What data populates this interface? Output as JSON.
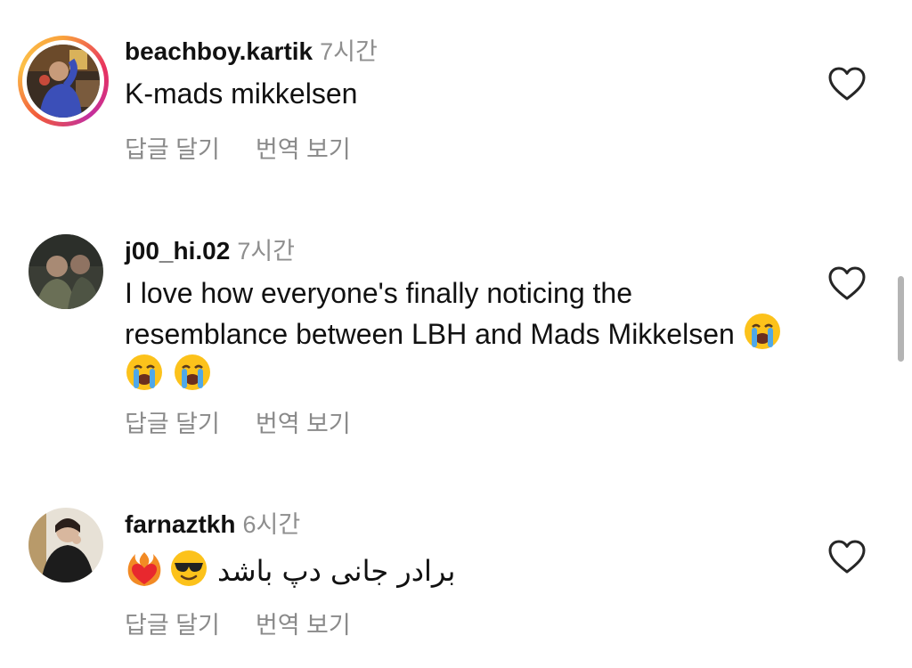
{
  "comments": [
    {
      "username": "beachboy.kartik",
      "time": "7시간",
      "text": "K-mads mikkelsen",
      "reply_label": "답글 달기",
      "translate_label": "번역 보기",
      "has_story_ring": true
    },
    {
      "username": "j00_hi.02",
      "time": "7시간",
      "text": "I love how everyone's finally noticing the resemblance between LBH and Mads Mikkelsen",
      "reply_label": "답글 달기",
      "translate_label": "번역 보기",
      "emojis": [
        "loudly-crying-face",
        "loudly-crying-face",
        "loudly-crying-face"
      ]
    },
    {
      "username": "farnaztkh",
      "time": "6시간",
      "emojis": [
        "heart-on-fire",
        "smiling-face-with-sunglasses"
      ],
      "text": "برادر جانی دپ باشد",
      "reply_label": "답글 달기",
      "translate_label": "번역 보기"
    }
  ],
  "icons": {
    "like": "heart-outline-icon"
  },
  "colors": {
    "text": "#111111",
    "secondary": "#8e8e8e",
    "scrollbar": "#b4b4b4"
  }
}
